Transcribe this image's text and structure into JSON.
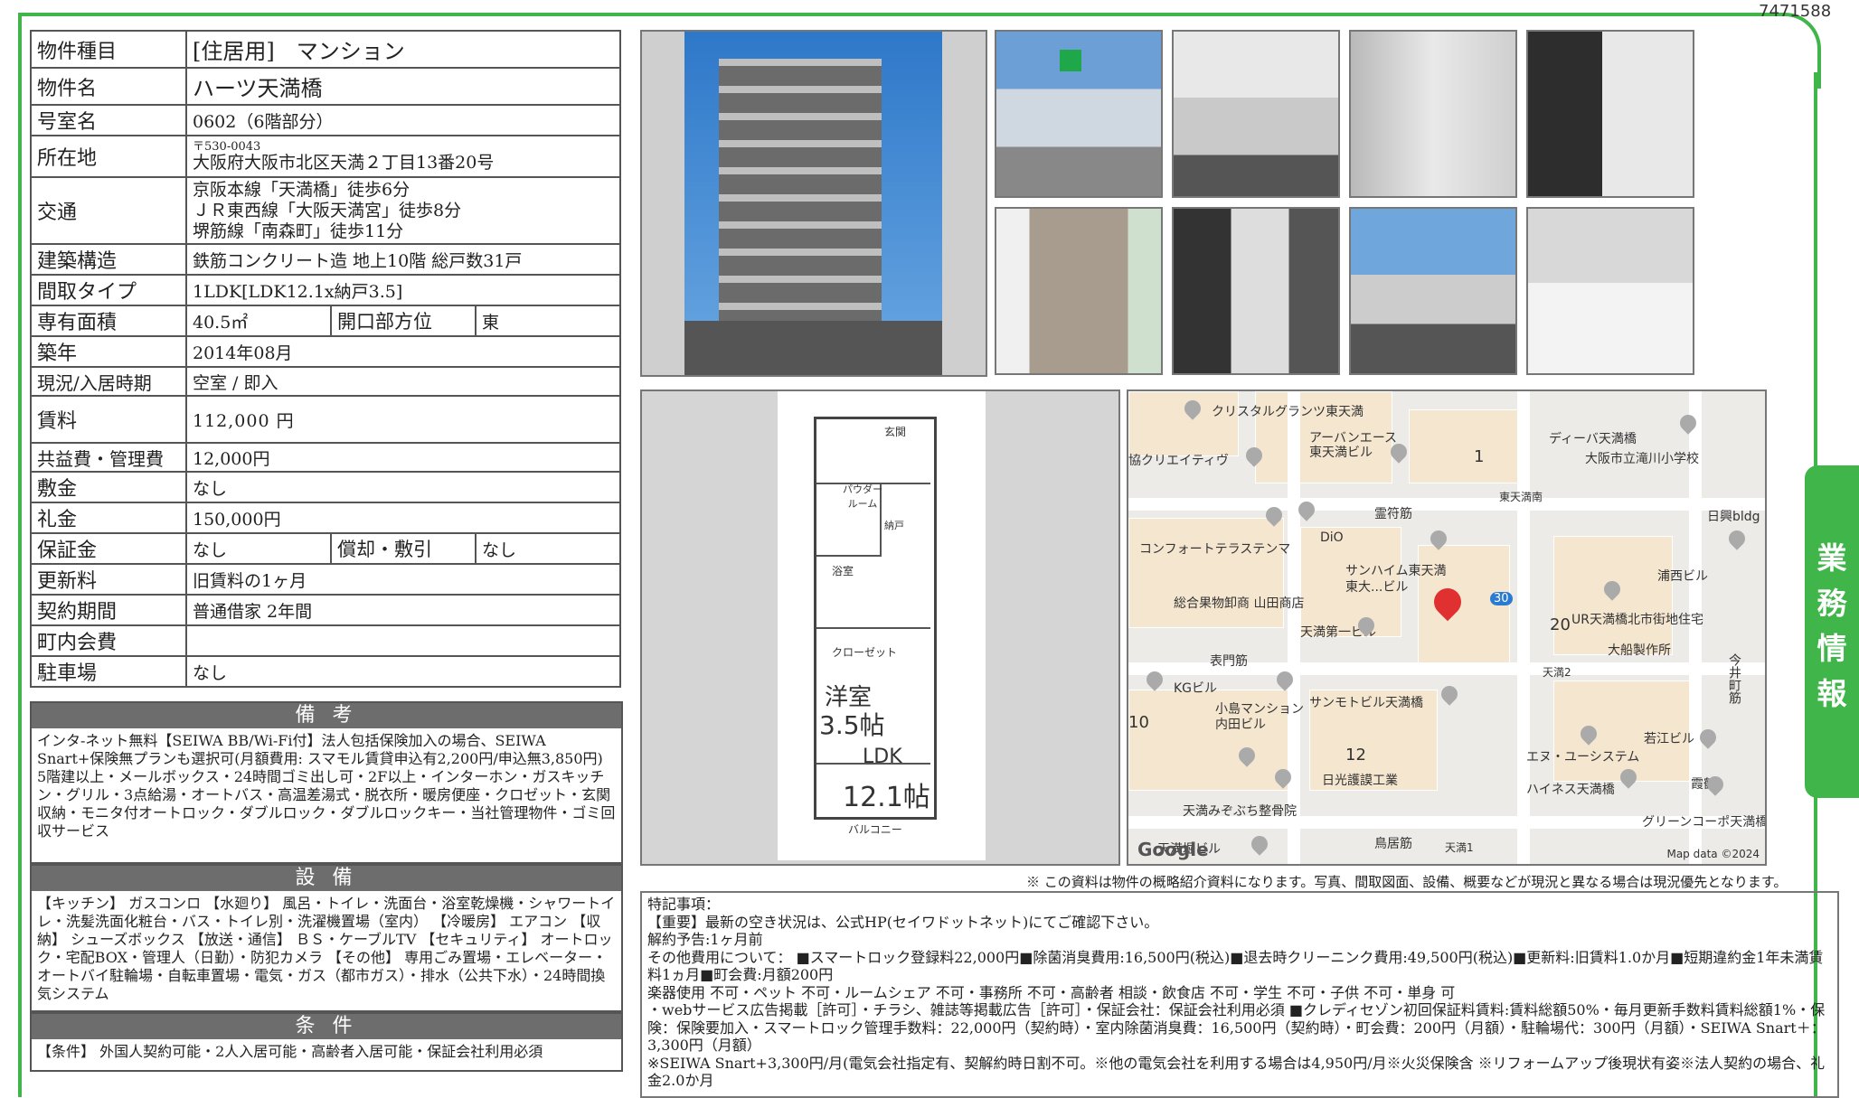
{
  "doc_id": "7471588",
  "info": {
    "type_label": "物件種目",
    "type_value": "[住居用]　マンション",
    "name_label": "物件名",
    "name_value": "ハーツ天満橋",
    "room_label": "号室名",
    "room_value": "0602（6階部分）",
    "address_label": "所在地",
    "postal": "〒530-0043",
    "address": "大阪府大阪市北区天満２丁目13番20号",
    "traffic_label": "交通",
    "traffic": [
      "京阪本線「天満橋」徒歩6分",
      "ＪＲ東西線「大阪天満宮」徒歩8分",
      "堺筋線「南森町」徒歩11分"
    ],
    "structure_label": "建築構造",
    "structure_value": "鉄筋コンクリート造 地上10階 総戸数31戸",
    "layout_label": "間取タイプ",
    "layout_value": "1LDK[LDK12.1x納戸3.5]",
    "area_label": "専有面積",
    "area_value": "40.5㎡",
    "direction_label": "開口部方位",
    "direction_value": "東",
    "built_label": "築年",
    "built_value": "2014年08月",
    "status_label": "現況/入居時期",
    "status_value": "空室 / 即入",
    "rent_label": "賃料",
    "rent_value": "112,000 円",
    "fee_label": "共益費・管理費",
    "fee_value": "12,000円",
    "deposit_label": "敷金",
    "deposit_value": "なし",
    "key_label": "礼金",
    "key_value": "150,000円",
    "guarantee_label": "保証金",
    "guarantee_value": "なし",
    "amort_label": "償却・敷引",
    "amort_value": "なし",
    "renewal_label": "更新料",
    "renewal_value": "旧賃料の1ヶ月",
    "contract_label": "契約期間",
    "contract_value": "普通借家 2年間",
    "assoc_label": "町内会費",
    "assoc_value": "",
    "parking_label": "駐車場",
    "parking_value": "なし"
  },
  "remarks": {
    "title": "備 考",
    "text": "インタ-ネット無料【SEIWA BB/Wi-Fi付】法人包括保険加入の場合、SEIWA Snart+保険無プランも選択可(月額費用: スマモル賃貸申込有2,200円/申込無3,850円)\n5階建以上・メールボックス・24時間ゴミ出し可・2F以上・インターホン・ガスキッチン・グリル・3点給湯・オートバス・高温差湯式・脱衣所・暖房便座・クロゼット・玄関収納・モニタ付オートロック・ダブルロック・ダブルロックキー・当社管理物件・ゴミ回収サービス"
  },
  "equipment": {
    "title": "設 備",
    "text": "【キッチン】 ガスコンロ 【水廻り】 風呂・トイレ・洗面台・浴室乾燥機・シャワートイレ・洗髪洗面化粧台・バス・トイレ別・洗濯機置場（室内） 【冷暖房】 エアコン 【収納】 シューズボックス 【放送・通信】 ＢＳ・ケーブルTV 【セキュリティ】 オートロック・宅配BOX・管理人（日勤）・防犯カメラ 【その他】 専用ごみ置場・エレベーター・オートバイ駐輪場・自転車置場・電気・ガス（都市ガス）・排水（公共下水）・24時間換気システム"
  },
  "conditions": {
    "title": "条 件",
    "text": "【条件】 外国人契約可能・2人入居可能・高齢者入居可能・保証会社利用必須"
  },
  "floorplan": {
    "entrance": "玄関",
    "powder": "パウダー\nルーム",
    "bath": "浴室",
    "storage": "納戸",
    "western": "洋室",
    "western_size": "3.5帖",
    "closet": "クローゼット",
    "ldk": "LDK",
    "ldk_size": "12.1帖",
    "balcony": "バルコニー"
  },
  "map": {
    "labels": [
      "クリスタルグランツ東天満",
      "アーバンエース\n東天満ビル",
      "ディーバ天満橋",
      "大阪市立滝川小学校",
      "協クリエイティヴ",
      "東天満南",
      "霊符筋",
      "日興bldg",
      "DiO",
      "コンフォートテラステンマ",
      "サンハイム東天満\n東大...ビル",
      "浦西ビル",
      "総合果物卸商 山田商店",
      "UR天満橋北市街地住宅",
      "天満第一ビル",
      "大船製作所",
      "表門筋",
      "天満2",
      "今井町筋",
      "KGビル",
      "サンモトビル天満橋",
      "小島マンション\n内田ビル",
      "若江ビル",
      "エヌ・ユーシステム",
      "霞鶴",
      "日光護謨工業",
      "ハイネス天満橋",
      "天満みぞぶち整骨院",
      "グリーンコーポ天満橋",
      "天満堀ビル",
      "鳥居筋",
      "天満1"
    ],
    "numbers": [
      "1",
      "20",
      "10",
      "12"
    ],
    "route": "30",
    "google": "Google",
    "mapdata": "Map data ©2024"
  },
  "disclaimer": "※ この資料は物件の概略紹介資料になります。写真、間取図面、設備、概要などが現況と異なる場合は現況優先となります。",
  "special": {
    "lines": [
      "特記事項：",
      "【重要】最新の空き状況は、公式HP(セイワドットネット)にてご確認下さい。",
      "解約予告:1ヶ月前",
      "その他費用について： ■スマートロック登録料22,000円■除菌消臭費用:16,500円(税込)■退去時クリーニンク費用:49,500円(税込)■更新料:旧賃料1.0か月■短期違約金1年未満賃料1ヵ月■町会費:月額200円",
      "楽器使用 不可・ペット 不可・ルームシェア 不可・事務所 不可・高齢者 相談・飲食店 不可・学生 不可・子供 不可・単身 可",
      "・webサービス広告掲載［許可］・チラシ、雑誌等掲載広告［許可］・保証会社：保証会社利用必須 ■クレディセゾン初回保証料賃料:賃料総額50%・毎月更新手数料賃料総額1%・保険：保険要加入・スマートロック管理手数料：22,000円（契約時）・室内除菌消臭費：16,500円（契約時）・町会費：200円（月額）・駐輪場代：300円（月額）・SEIWA Snart＋：3,300円（月額）",
      "※SEIWA Snart+3,300円/月(電気会社指定有、契解約時日割不可。※他の電気会社を利用する場合は4,950円/月※火災保険含 ※リフォームアップ後現状有姿※法人契約の場合、礼金2.0か月"
    ]
  },
  "tab": {
    "label": "業務情報"
  },
  "photos": [
    "building-exterior",
    "view-from-balcony",
    "kitchen",
    "living-room",
    "bathroom",
    "western-room",
    "hallway",
    "balcony",
    "toilet"
  ],
  "colors": {
    "accent": "#3fb54a",
    "section_header": "#6d6d6d",
    "pin": "#e03030"
  }
}
